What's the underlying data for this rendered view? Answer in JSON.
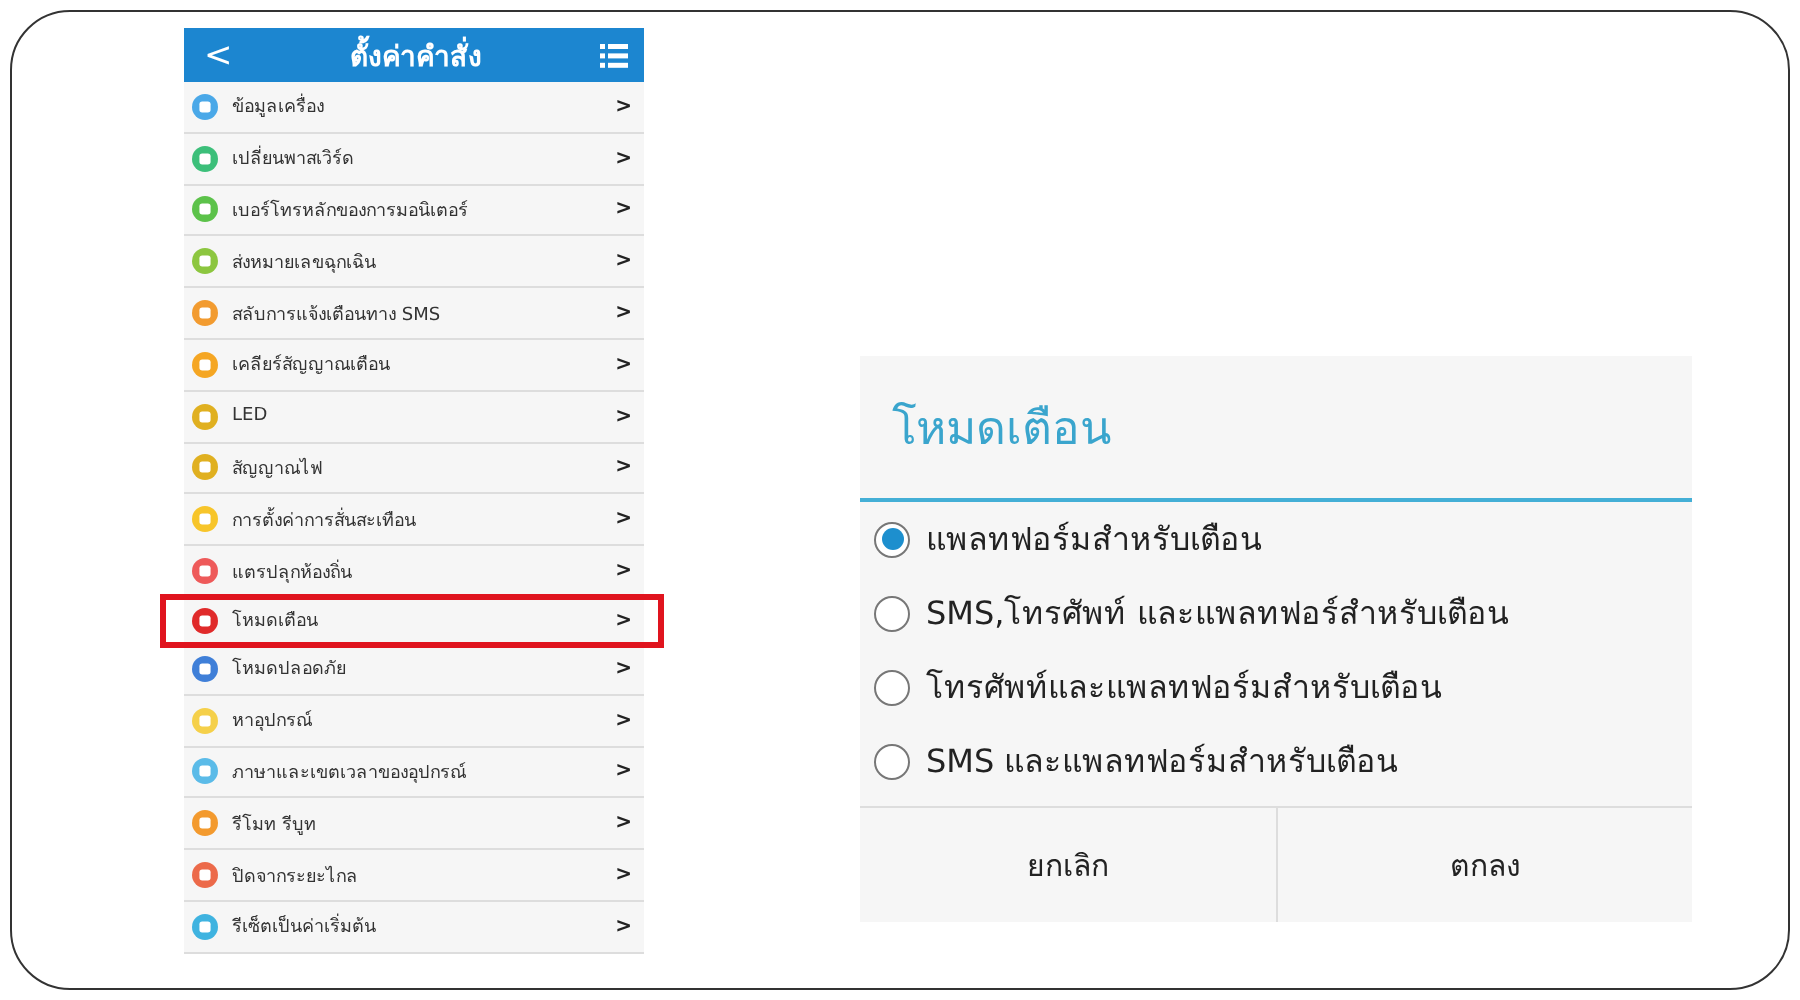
{
  "settings_screen": {
    "title": "ตั้งค่าคำสั่ง",
    "back": "<",
    "items": [
      {
        "label": "ข้อมูลเครื่อง",
        "color": "#4aa8e8",
        "highlighted": false
      },
      {
        "label": "เปลี่ยนพาสเวิร์ด",
        "color": "#3cbf7a",
        "highlighted": false
      },
      {
        "label": "เบอร์โทรหลักของการมอนิเตอร์",
        "color": "#5cc24a",
        "highlighted": false
      },
      {
        "label": "ส่งหมายเลขฉุกเฉิน",
        "color": "#8cc63f",
        "highlighted": false
      },
      {
        "label": "สลับการแจ้งเตือนทาง SMS",
        "color": "#f29b30",
        "highlighted": false
      },
      {
        "label": "เคลียร์สัญญาณเตือน",
        "color": "#f5a623",
        "highlighted": false
      },
      {
        "label": "LED",
        "color": "#e0b020",
        "highlighted": false
      },
      {
        "label": "สัญญาณไฟ",
        "color": "#e0b020",
        "highlighted": false
      },
      {
        "label": "การตั้งค่าการสั่นสะเทือน",
        "color": "#f7c52a",
        "highlighted": false
      },
      {
        "label": "แตรปลุกห้องถิ่น",
        "color": "#ee5a5a",
        "highlighted": false
      },
      {
        "label": "โหมดเตือน",
        "color": "#e02a2a",
        "highlighted": true
      },
      {
        "label": "โหมดปลอดภัย",
        "color": "#3f7fd8",
        "highlighted": false
      },
      {
        "label": "หาอุปกรณ์",
        "color": "#f5d04a",
        "highlighted": false
      },
      {
        "label": "ภาษาและเขตเวลาของอุปกรณ์",
        "color": "#5bbbe8",
        "highlighted": false
      },
      {
        "label": "รีโมท รีบูท",
        "color": "#f39a2e",
        "highlighted": false
      },
      {
        "label": "ปิดจากระยะไกล",
        "color": "#ec6a4a",
        "highlighted": false
      },
      {
        "label": "รีเซ็ตเป็นค่าเริ่มต้น",
        "color": "#3fb3e0",
        "highlighted": false
      }
    ],
    "chevron": ">"
  },
  "dialog": {
    "title": "โหมดเตือน",
    "options": [
      {
        "label": "แพลทฟอร์มสำหรับเตือน",
        "selected": true
      },
      {
        "label": "SMS,โทรศัพท์ และแพลทฟอร์สำหรับเตือน",
        "selected": false
      },
      {
        "label": "โทรศัพท์และแพลทฟอร์มสำหรับเตือน",
        "selected": false
      },
      {
        "label": "SMS และแพลทฟอร์มสำหรับเตือน",
        "selected": false
      }
    ],
    "buttons": [
      "ยกเลิก",
      "ตกลง"
    ]
  }
}
